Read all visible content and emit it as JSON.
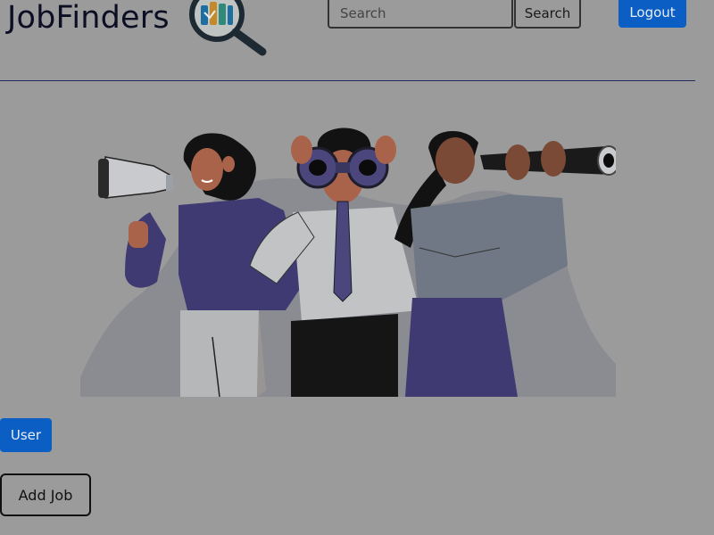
{
  "header": {
    "brand": "JobFinders",
    "logo_icon": "magnifier-logo-icon",
    "search": {
      "placeholder": "Search",
      "value": "",
      "button_label": "Search"
    },
    "logout_label": "Logout"
  },
  "hero": {
    "illustration": "three-people-searching-illustration"
  },
  "actions": {
    "user_label": "User",
    "add_job_label": "Add Job"
  },
  "colors": {
    "background": "#9b9b9b",
    "primary": "#0a5ec4",
    "brand_text": "#0c0f24",
    "divider": "#202a5c"
  }
}
